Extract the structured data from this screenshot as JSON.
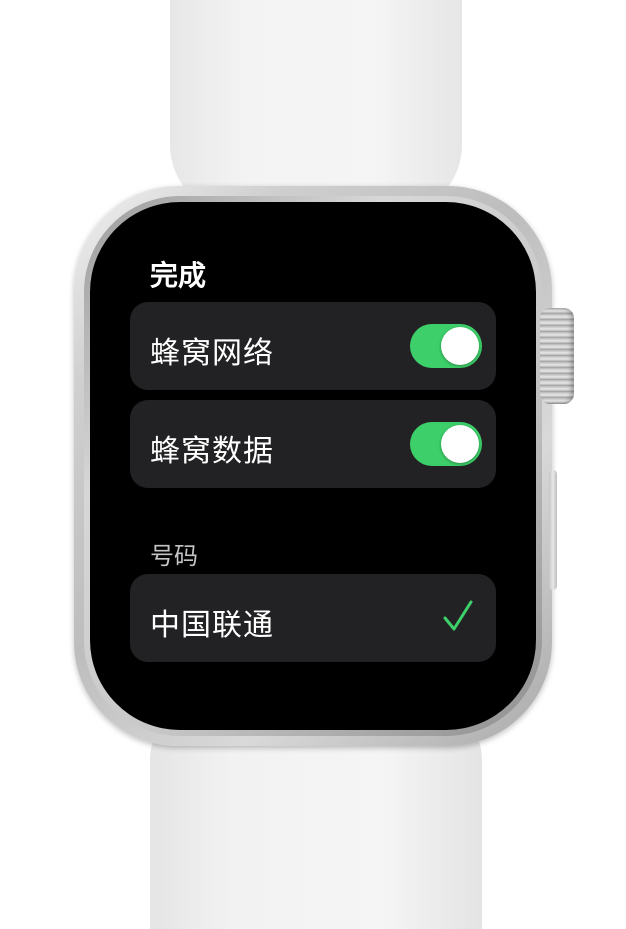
{
  "header": {
    "done_label": "完成"
  },
  "settings": {
    "cellular": {
      "label": "蜂窝网络",
      "enabled": true
    },
    "cellular_data": {
      "label": "蜂窝数据",
      "enabled": true
    }
  },
  "number_section": {
    "title": "号码",
    "carrier": {
      "label": "中国联通",
      "selected": true
    }
  },
  "colors": {
    "accent_green": "#3dd06a",
    "row_background": "#222224",
    "screen_background": "#000000"
  },
  "icons": {
    "checkmark": "checkmark-icon"
  }
}
